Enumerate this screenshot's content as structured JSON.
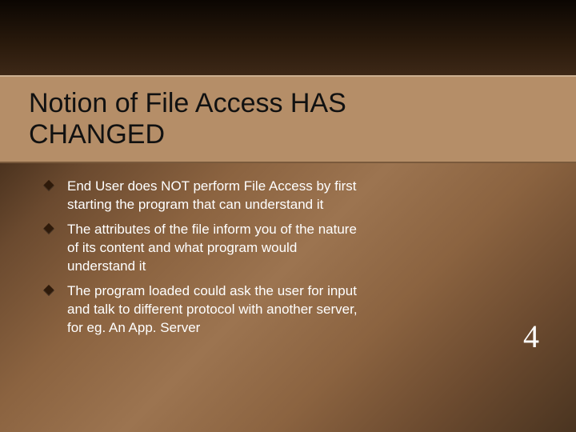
{
  "title": "Notion of File Access HAS CHANGED",
  "bullets": [
    "End User does NOT perform File Access by first starting the program that can understand it",
    "The attributes of the file inform you of the nature of its content and what program would understand it",
    "The program loaded could ask the user for input and talk to different protocol with another server, for eg. An App. Server"
  ],
  "page_number": "4"
}
